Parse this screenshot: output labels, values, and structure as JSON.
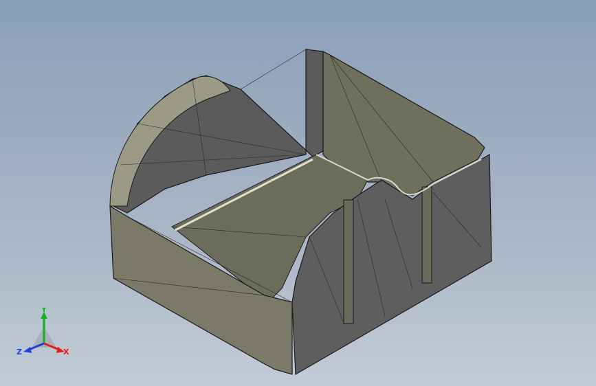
{
  "viewport": {
    "background_top": "#8a9fb8",
    "background_bottom": "#c3ccd6"
  },
  "model": {
    "face_dark": "#5b5b5b",
    "face_olive": "#6f6f5e",
    "face_side": "#7b7a68",
    "edge": "#1a1a1a"
  },
  "triad": {
    "labels": {
      "x": "X",
      "y": "Y",
      "z": "Z"
    },
    "colors": {
      "x": "#e02020",
      "y": "#10b020",
      "z": "#2040e0"
    }
  }
}
